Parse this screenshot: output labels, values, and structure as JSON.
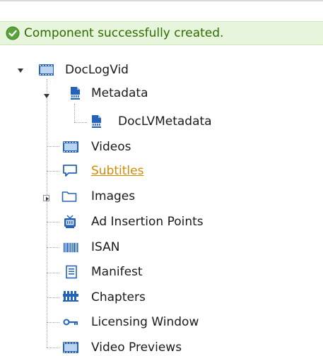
{
  "banner": {
    "message": "Component successfully created.",
    "icon": "check-circle-icon",
    "color": "#2e6b00"
  },
  "tree": {
    "root": {
      "label": "DocLogVid",
      "icon": "video-icon",
      "state": "expanded"
    },
    "items": [
      {
        "label": "Metadata",
        "icon": "metadata-icon",
        "state": "expanded"
      },
      {
        "label": "DocLVMetadata",
        "icon": "metadata-icon",
        "state": "leaf"
      },
      {
        "label": "Videos",
        "icon": "video-icon",
        "state": "leaf"
      },
      {
        "label": "Subtitles",
        "icon": "speech-bubble-icon",
        "state": "leaf",
        "style": "link"
      },
      {
        "label": "Images",
        "icon": "folder-icon",
        "state": "collapsed"
      },
      {
        "label": "Ad Insertion Points",
        "icon": "tv-icon",
        "state": "leaf"
      },
      {
        "label": "ISAN",
        "icon": "barcode-icon",
        "state": "leaf"
      },
      {
        "label": "Manifest",
        "icon": "document-icon",
        "state": "leaf"
      },
      {
        "label": "Chapters",
        "icon": "chapters-icon",
        "state": "leaf"
      },
      {
        "label": "Licensing Window",
        "icon": "key-icon",
        "state": "leaf"
      },
      {
        "label": "Video Previews",
        "icon": "video-icon",
        "state": "leaf"
      }
    ]
  },
  "colors": {
    "link": "#d28a00",
    "icon_blue": "#1f5fa8",
    "banner_bg": "#e7f5dc"
  }
}
